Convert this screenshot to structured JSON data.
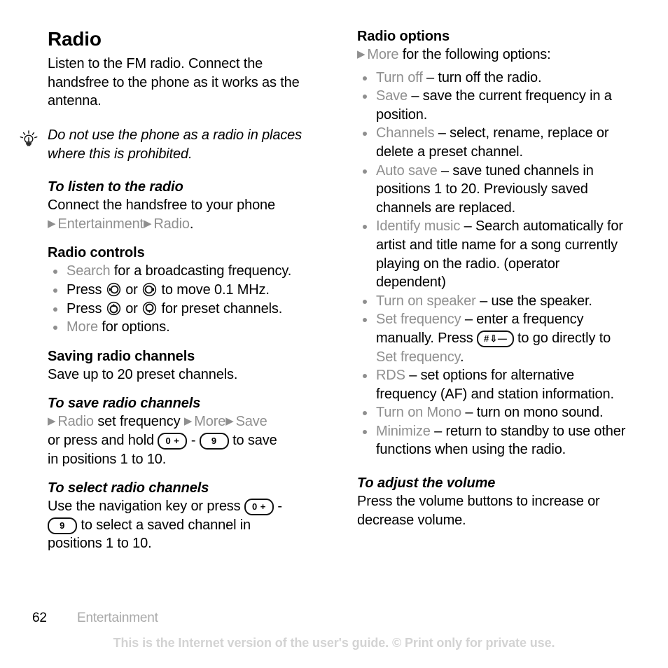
{
  "document": {
    "title": "Radio",
    "intro": "Listen to the FM radio. Connect the handsfree to the phone as it works as the antenna.",
    "tip": {
      "icon": "lightbulb-icon",
      "text": "Do not use the phone as a radio in places where this is prohibited."
    }
  },
  "left_column": {
    "listen": {
      "heading": "To listen to the radio",
      "line1": "Connect the handsfree to your phone",
      "path": {
        "arrow": "▶",
        "item1": "Entertainment",
        "item2": "Radio",
        "period": "."
      }
    },
    "controls": {
      "heading": "Radio controls",
      "items": [
        {
          "ui_term": "Search",
          "rest": " for a broadcasting frequency."
        },
        {
          "prefix": "Press ",
          "icon1": "nav-key-left-icon",
          "mid": " or ",
          "icon2": "nav-key-right-icon",
          "rest": " to move 0.1 MHz."
        },
        {
          "prefix": "Press ",
          "icon1": "nav-key-up-icon",
          "mid": " or ",
          "icon2": "nav-key-down-icon",
          "rest": " for preset channels."
        },
        {
          "ui_term": "More",
          "rest": " for options."
        }
      ]
    },
    "saving": {
      "heading": "Saving radio channels",
      "text": "Save up to 20 preset channels."
    },
    "save_channels": {
      "heading": "To save radio channels",
      "arrow": "▶",
      "radio": "Radio",
      "set_frequency_text": " set frequency ",
      "more": "More",
      "save": "Save",
      "tail_1": "or press and hold ",
      "key_low": "0 +",
      "dash": " - ",
      "key_high": "9",
      "tail_2": " to save",
      "tail_3": "in positions 1 to 10."
    },
    "select_channels": {
      "heading": "To select radio channels",
      "tail_1": "Use the navigation key or press ",
      "key_low": "0 +",
      "dash": " - ",
      "key_high": "9",
      "tail_2": " to select a saved channel in",
      "tail_3": "positions 1 to 10."
    }
  },
  "right_column": {
    "options": {
      "heading": "Radio options",
      "lead": {
        "arrow": "▶",
        "ui_term": "More",
        "rest": " for the following options:"
      },
      "items": [
        {
          "ui_term": "Turn off",
          "rest": " – turn off the radio."
        },
        {
          "ui_term": "Save",
          "rest": " – save the current frequency in a position."
        },
        {
          "ui_term": "Channels",
          "rest": " – select, rename, replace or delete a preset channel."
        },
        {
          "ui_term": "Auto save",
          "rest": " – save tuned channels in positions 1 to 20. Previously saved channels are replaced."
        },
        {
          "ui_term": "Identify music",
          "rest": " – Search automatically for artist and title name for a song currently playing on the radio. (operator dependent)"
        },
        {
          "ui_term": "Turn on speaker",
          "rest": " – use the speaker."
        },
        {
          "ui_term": "Set frequency",
          "rest_a": " – enter a frequency manually. Press ",
          "key": "#",
          "rest_b": " to go directly to ",
          "ui_term_2": "Set frequency",
          "rest_c": "."
        },
        {
          "ui_term": "RDS",
          "rest": " – set options for alternative frequency (AF) and station information."
        },
        {
          "ui_term": "Turn on Mono",
          "rest": " – turn on mono sound."
        },
        {
          "ui_term": "Minimize",
          "rest": " – return to standby to use other functions when using the radio."
        }
      ]
    },
    "volume": {
      "heading": "To adjust the volume",
      "text": "Press the volume buttons to increase or decrease volume."
    }
  },
  "footer": {
    "page_number": "62",
    "chapter": "Entertainment",
    "disclaimer": "This is the Internet version of the user's guide. © Print only for private use."
  },
  "colors": {
    "ui_term_grey": "#8f8f8f",
    "body_black": "#000000",
    "footer_chapter_grey": "#a9a9a9",
    "disclaimer_grey": "#d3d3d3",
    "page_background": "#ffffff"
  }
}
